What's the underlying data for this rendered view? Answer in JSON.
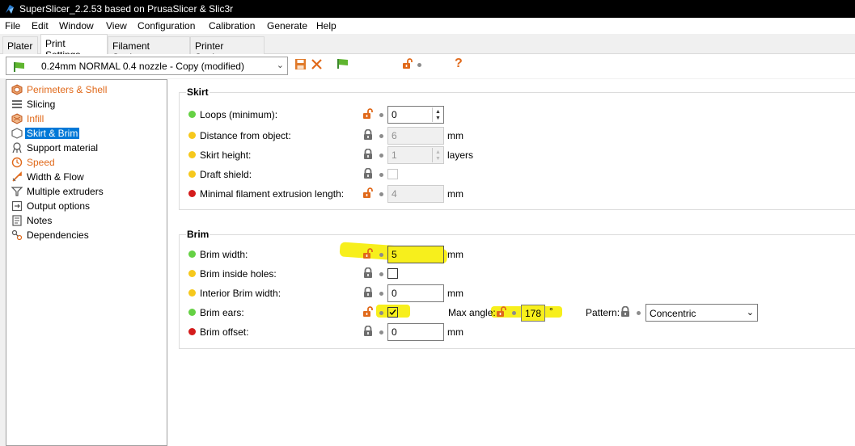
{
  "window": {
    "title": "SuperSlicer_2.2.53 based on PrusaSlicer & Slic3r"
  },
  "menu": [
    "File",
    "Edit",
    "Window",
    "View",
    "Configuration",
    "Calibration",
    "Generate",
    "Help"
  ],
  "tabs": [
    "Plater",
    "Print Settings",
    "Filament Settings",
    "Printer Settings"
  ],
  "active_tab": "Print Settings",
  "preset": {
    "selected": "0.24mm NORMAL 0.4 nozzle - Copy (modified)",
    "help_symbol": "?"
  },
  "sidebar": [
    {
      "label": "Perimeters & Shell",
      "icon": "perimeters-icon",
      "modified": true
    },
    {
      "label": "Slicing",
      "icon": "layers-icon",
      "modified": false
    },
    {
      "label": "Infill",
      "icon": "infill-icon",
      "modified": true
    },
    {
      "label": "Skirt & Brim",
      "icon": "skirt-icon",
      "modified": false,
      "selected": true
    },
    {
      "label": "Support material",
      "icon": "support-icon",
      "modified": false
    },
    {
      "label": "Speed",
      "icon": "clock-icon",
      "modified": true
    },
    {
      "label": "Width & Flow",
      "icon": "width-icon",
      "modified": false
    },
    {
      "label": "Multiple extruders",
      "icon": "funnel-icon",
      "modified": false
    },
    {
      "label": "Output options",
      "icon": "output-icon",
      "modified": false
    },
    {
      "label": "Notes",
      "icon": "notes-icon",
      "modified": false
    },
    {
      "label": "Dependencies",
      "icon": "dependencies-icon",
      "modified": false
    }
  ],
  "skirt": {
    "title": "Skirt",
    "loops": {
      "label": "Loops (minimum):",
      "value": "0"
    },
    "distance": {
      "label": "Distance from object:",
      "value": "6",
      "unit": "mm"
    },
    "height": {
      "label": "Skirt height:",
      "value": "1",
      "unit": "layers"
    },
    "draft_shield": {
      "label": "Draft shield:",
      "checked": false
    },
    "min_extrusion": {
      "label": "Minimal filament extrusion length:",
      "value": "4",
      "unit": "mm"
    }
  },
  "brim": {
    "title": "Brim",
    "width": {
      "label": "Brim width:",
      "value": "5",
      "unit": "mm"
    },
    "inside_holes": {
      "label": "Brim inside holes:",
      "checked": false
    },
    "interior_width": {
      "label": "Interior Brim width:",
      "value": "0",
      "unit": "mm"
    },
    "ears": {
      "label": "Brim ears:",
      "checked": true,
      "max_angle_label": "Max angle:",
      "max_angle_value": "178",
      "max_angle_unit": "°",
      "pattern_label": "Pattern:",
      "pattern_value": "Concentric"
    },
    "offset": {
      "label": "Brim offset:",
      "value": "0",
      "unit": "mm"
    }
  },
  "colors": {
    "modified_orange": "#e0691a",
    "selection_blue": "#0078d7",
    "highlight_yellow": "#f7ef1c",
    "dot_green": "#65d144",
    "dot_yellow": "#f6c81c",
    "dot_red": "#d41c1c"
  }
}
